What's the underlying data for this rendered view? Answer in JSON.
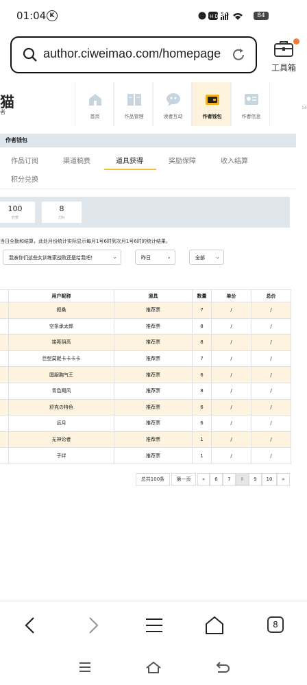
{
  "status_bar": {
    "time": "01:04",
    "k_badge": "K",
    "hd": "HD",
    "net": "5G",
    "battery": "84"
  },
  "browser": {
    "url": "author.ciweimao.com/homepage",
    "toolbox_label": "工具箱"
  },
  "site": {
    "logo": "猫",
    "logo_sub": "者",
    "nav": [
      {
        "label": "首页",
        "icon": "home-icon"
      },
      {
        "label": "作品管理",
        "icon": "book-icon"
      },
      {
        "label": "读者互动",
        "icon": "chat-icon"
      },
      {
        "label": "作者钱包",
        "icon": "wallet-icon"
      },
      {
        "label": "作者信息",
        "icon": "profile-card-icon"
      }
    ],
    "edge_number": "14"
  },
  "wallet": {
    "title": "作者钱包",
    "tabs": [
      "作品订阅",
      "渠道稿费",
      "道具获得",
      "奖励保障",
      "收入结算",
      "积分兑换"
    ],
    "active_tab": "道具获得",
    "stats": [
      {
        "value": "100",
        "unit": "打赏"
      },
      {
        "value": "8",
        "unit": "刀片"
      }
    ],
    "note": "当日全勤和结算，此处月份统计实际显示每月1号6时到次月1号6时的统计结果。",
    "filters": {
      "book": "我亲你们这些女训练家战败还是给我吧！",
      "date": "昨日",
      "type": "全部"
    }
  },
  "table": {
    "headers": [
      "用户昵称",
      "道具",
      "数量",
      "单价",
      "总价"
    ],
    "rows": [
      [
        "叙桑",
        "推荐票",
        "7",
        "/",
        "/"
      ],
      [
        "空条承太郎",
        "推荐票",
        "8",
        "/",
        "/"
      ],
      [
        "竣莠阴高",
        "推荐票",
        "8",
        "/",
        "/"
      ],
      [
        "巨型莫妮卡卡卡卡",
        "推荐票",
        "7",
        "/",
        "/"
      ],
      [
        "国服胸气王",
        "推荐票",
        "6",
        "/",
        "/"
      ],
      [
        "青色飓风",
        "推荐票",
        "8",
        "/",
        "/"
      ],
      [
        "舒克の特色",
        "推荐票",
        "6",
        "/",
        "/"
      ],
      [
        "远月",
        "推荐票",
        "6",
        "/",
        "/"
      ],
      [
        "无神论者",
        "推荐票",
        "1",
        "/",
        "/"
      ],
      [
        "子绊",
        "推荐票",
        "1",
        "/",
        "/"
      ]
    ]
  },
  "pagination": {
    "total": "总共100条",
    "first": "第一页",
    "prev": "«",
    "pages": [
      "6",
      "7",
      "8",
      "9",
      "10"
    ],
    "current": "8",
    "next": "»"
  },
  "bottom_nav": {
    "tab_count": "8"
  }
}
